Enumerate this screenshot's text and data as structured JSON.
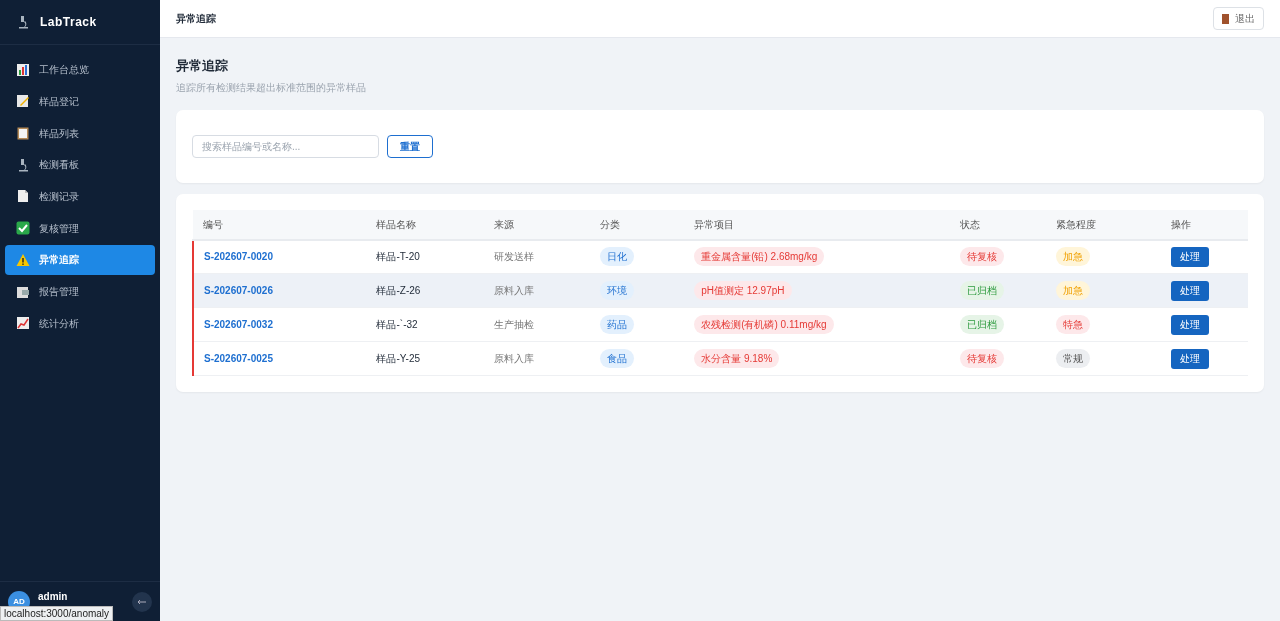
{
  "sidebar": {
    "brand": "LabTrack",
    "items": [
      {
        "label": "工作台总览",
        "selected": false
      },
      {
        "label": "样品登记",
        "selected": false
      },
      {
        "label": "样品列表",
        "selected": false
      },
      {
        "label": "检测看板",
        "selected": false
      },
      {
        "label": "检测记录",
        "selected": false
      },
      {
        "label": "复核管理",
        "selected": false
      },
      {
        "label": "异常追踪",
        "selected": true
      },
      {
        "label": "报告管理",
        "selected": false
      },
      {
        "label": "统计分析",
        "selected": false
      }
    ],
    "user": {
      "avatar": "AD",
      "name": "admin"
    }
  },
  "topbar": {
    "title": "异常追踪",
    "logout": "退出"
  },
  "page": {
    "title": "异常追踪",
    "subtitle": "追踪所有检测结果超出标准范围的异常样品"
  },
  "search": {
    "placeholder": "搜索样品编号或名称...",
    "reset": "重置"
  },
  "table": {
    "columns": [
      "编号",
      "样品名称",
      "来源",
      "分类",
      "异常项目",
      "状态",
      "紧急程度",
      "操作"
    ],
    "rows": [
      {
        "id": "S-202607-0020",
        "name": "样品-T-20",
        "source": "研发送样",
        "category": "日化",
        "anomaly": "重金属含量(铅) 2.68mg/kg",
        "status": {
          "text": "待复核",
          "kind": "pending"
        },
        "urgency": {
          "text": "加急",
          "kind": "urgent"
        },
        "action": "处理",
        "highlighted": false
      },
      {
        "id": "S-202607-0026",
        "name": "样品-Z-26",
        "source": "原料入库",
        "category": "环境",
        "anomaly": "pH值测定 12.97pH",
        "status": {
          "text": "已归档",
          "kind": "archived"
        },
        "urgency": {
          "text": "加急",
          "kind": "urgent"
        },
        "action": "处理",
        "highlighted": true
      },
      {
        "id": "S-202607-0032",
        "name": "样品-`-32",
        "source": "生产抽检",
        "category": "药品",
        "anomaly": "农残检测(有机磷) 0.11mg/kg",
        "status": {
          "text": "已归档",
          "kind": "archived"
        },
        "urgency": {
          "text": "特急",
          "kind": "critical"
        },
        "action": "处理",
        "highlighted": false
      },
      {
        "id": "S-202607-0025",
        "name": "样品-Y-25",
        "source": "原料入库",
        "category": "食品",
        "anomaly": "水分含量 9.18%",
        "status": {
          "text": "待复核",
          "kind": "pending"
        },
        "urgency": {
          "text": "常规",
          "kind": "normal"
        },
        "action": "处理",
        "highlighted": false
      }
    ]
  },
  "status_bar": {
    "url": "localhost:3000/anomaly"
  }
}
